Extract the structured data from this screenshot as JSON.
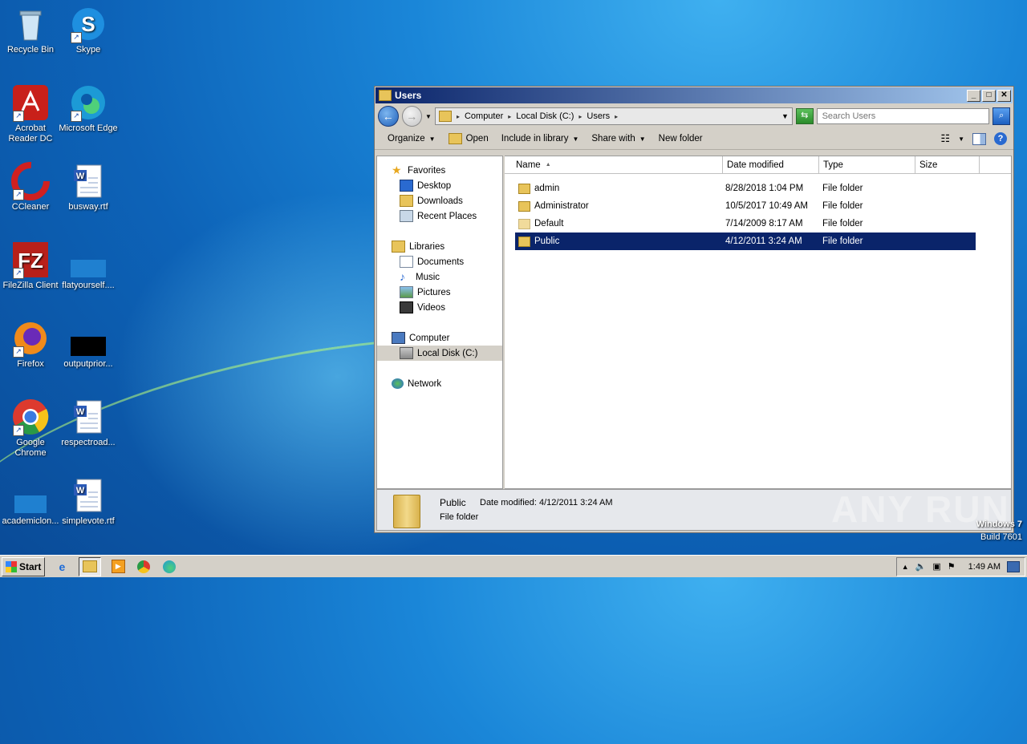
{
  "desktop": {
    "icons": [
      {
        "label": "Recycle Bin"
      },
      {
        "label": "Skype"
      },
      {
        "label": "Acrobat Reader DC"
      },
      {
        "label": "Microsoft Edge"
      },
      {
        "label": "CCleaner"
      },
      {
        "label": "busway.rtf"
      },
      {
        "label": "FileZilla Client"
      },
      {
        "label": "flatyourself...."
      },
      {
        "label": "Firefox"
      },
      {
        "label": "outputprior..."
      },
      {
        "label": "Google Chrome"
      },
      {
        "label": "respectroad..."
      },
      {
        "label": "academiclon..."
      },
      {
        "label": "simplevote.rtf"
      }
    ],
    "watermark": "ANY RUN",
    "os_text": {
      "line1": "Windows 7",
      "line2": "Build 7601"
    }
  },
  "window": {
    "title": "Users",
    "address": {
      "crumbs": [
        "Computer",
        "Local Disk (C:)",
        "Users"
      ]
    },
    "search_placeholder": "Search Users",
    "toolbar": {
      "organize": "Organize",
      "open": "Open",
      "include_in_library": "Include in library",
      "share_with": "Share with",
      "new_folder": "New folder"
    },
    "nav": {
      "favorites": "Favorites",
      "desktop": "Desktop",
      "downloads": "Downloads",
      "recent_places": "Recent Places",
      "libraries": "Libraries",
      "documents": "Documents",
      "music": "Music",
      "pictures": "Pictures",
      "videos": "Videos",
      "computer": "Computer",
      "local_disk": "Local Disk (C:)",
      "network": "Network"
    },
    "columns": {
      "name": "Name",
      "date_modified": "Date modified",
      "type": "Type",
      "size": "Size"
    },
    "files": [
      {
        "name": "admin",
        "date": "8/28/2018 1:04 PM",
        "type": "File folder"
      },
      {
        "name": "Administrator",
        "date": "10/5/2017 10:49 AM",
        "type": "File folder"
      },
      {
        "name": "Default",
        "date": "7/14/2009 8:17 AM",
        "type": "File folder"
      },
      {
        "name": "Public",
        "date": "4/12/2011 3:24 AM",
        "type": "File folder"
      }
    ],
    "details": {
      "name": "Public",
      "modified": "Date modified:  4/12/2011 3:24 AM",
      "type": "File folder"
    }
  },
  "taskbar": {
    "start": "Start",
    "clock": "1:49 AM"
  },
  "colors": {
    "selection": "#0a246a",
    "title_start": "#0a246a",
    "title_end": "#a6caf0"
  }
}
